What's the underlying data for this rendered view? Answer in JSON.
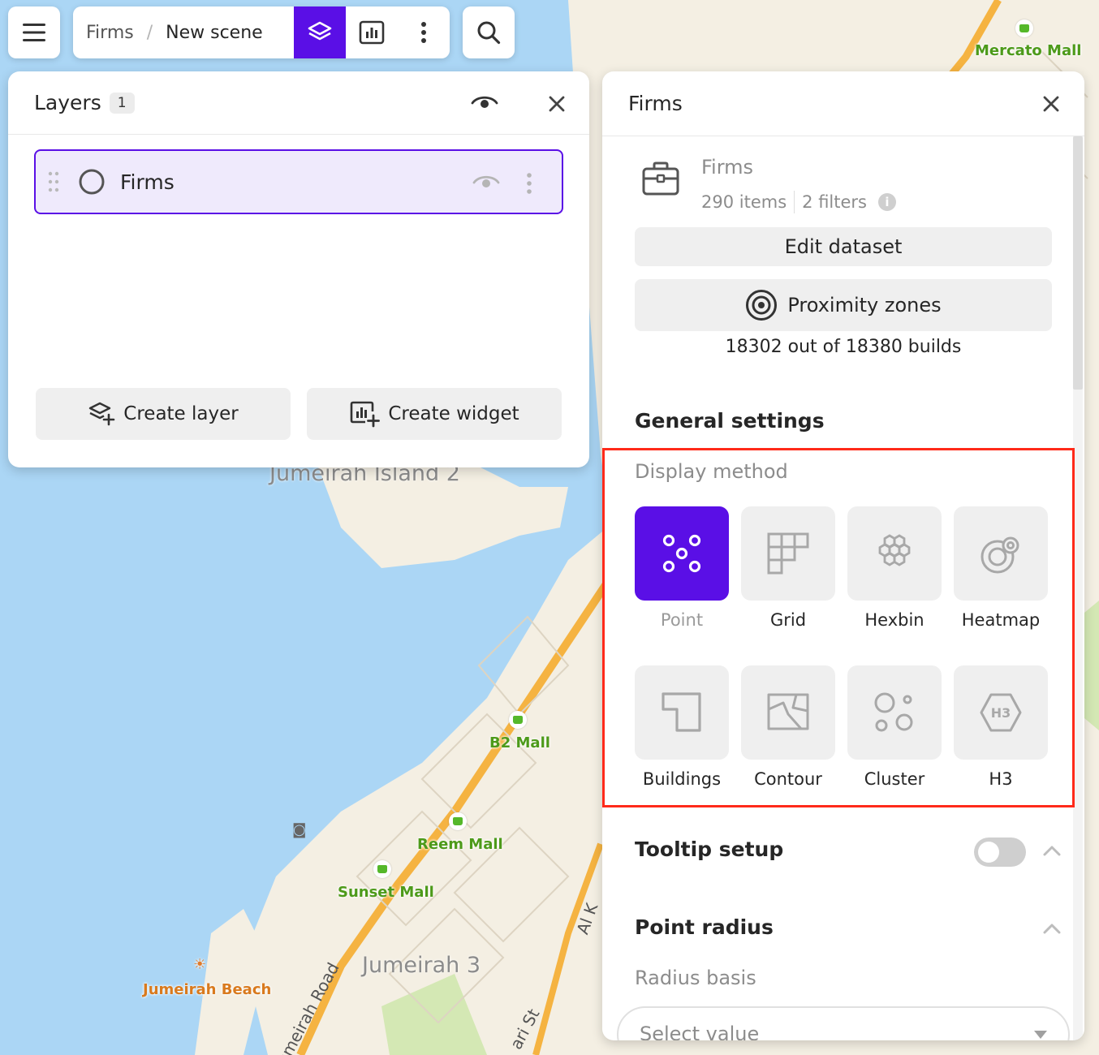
{
  "map": {
    "labels": {
      "mercato_mall": "Mercato Mall",
      "b2_mall": "B2 Mall",
      "reem_mall": "Reem Mall",
      "sunset_mall": "Sunset Mall",
      "jumeirah_beach": "Jumeirah Beach",
      "jumeirah_island_2": "Jumeirah Island 2",
      "jumeirah_3": "Jumeirah 3",
      "jumeirah_road": "Jumeirah Road",
      "road_al": "Al K",
      "road_st": "ari St"
    },
    "colors": {
      "water": "#abd6f5",
      "land": "#f4efe3",
      "road": "#f5b341",
      "park": "#d4e8b4"
    }
  },
  "toolbar": {
    "menu_icon": "hamburger-menu-icon",
    "breadcrumb_root": "Firms",
    "breadcrumb_separator": "/",
    "breadcrumb_current": "New scene",
    "layers_icon": "layers-icon",
    "widget_icon": "chart-widget-icon",
    "more_icon": "more-vertical-icon",
    "search_icon": "search-icon",
    "accent": "#5a0fe6"
  },
  "layers_panel": {
    "title": "Layers",
    "count": "1",
    "items": [
      {
        "label": "Firms"
      }
    ],
    "create_layer_label": "Create layer",
    "create_widget_label": "Create widget"
  },
  "firms_panel": {
    "title": "Firms",
    "dataset_name": "Firms",
    "items_count": "290 items",
    "filters_count": "2 filters",
    "edit_dataset_label": "Edit dataset",
    "proximity_label": "Proximity zones",
    "builds_text": "18302 out of 18380 builds",
    "general_settings_title": "General settings",
    "display_method_label": "Display method",
    "methods": [
      {
        "label": "Point",
        "icon": "point-icon",
        "selected": true
      },
      {
        "label": "Grid",
        "icon": "grid-icon",
        "selected": false
      },
      {
        "label": "Hexbin",
        "icon": "hexbin-icon",
        "selected": false
      },
      {
        "label": "Heatmap",
        "icon": "heatmap-icon",
        "selected": false
      },
      {
        "label": "Buildings",
        "icon": "buildings-icon",
        "selected": false
      },
      {
        "label": "Contour",
        "icon": "contour-icon",
        "selected": false
      },
      {
        "label": "Cluster",
        "icon": "cluster-icon",
        "selected": false
      },
      {
        "label": "H3",
        "icon": "h3-icon",
        "selected": false
      }
    ],
    "h3_glyph": "H3",
    "tooltip_setup_title": "Tooltip setup",
    "tooltip_enabled": false,
    "point_radius_title": "Point radius",
    "radius_basis_label": "Radius basis",
    "radius_select_placeholder": "Select value",
    "highlight_color": "#ff2a1a"
  }
}
